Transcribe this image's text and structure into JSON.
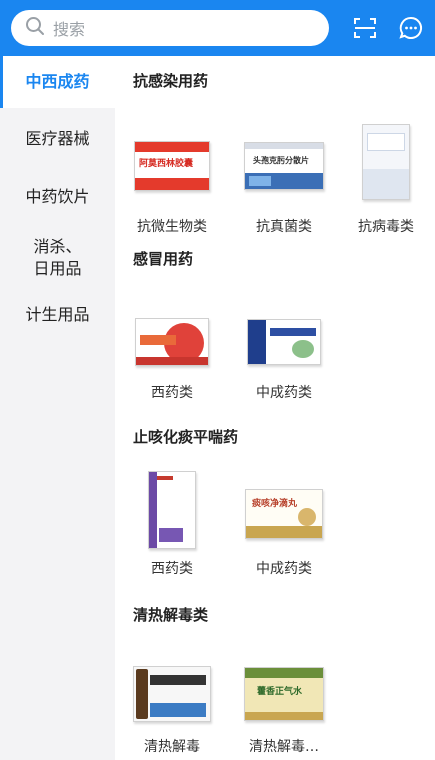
{
  "search": {
    "placeholder": "搜索"
  },
  "sidebar": {
    "items": [
      {
        "label": "中西成药",
        "active": true
      },
      {
        "label": "医疗器械"
      },
      {
        "label": "中药饮片"
      },
      {
        "label": "消杀、\n日用品"
      },
      {
        "label": "计生用品"
      }
    ]
  },
  "sections": [
    {
      "title": "抗感染用药",
      "products": [
        {
          "label": "抗微生物类",
          "box_text": "阿莫西林胶囊"
        },
        {
          "label": "抗真菌类",
          "box_text": "头孢克肟分散片"
        },
        {
          "label": "抗病毒类",
          "box_text": ""
        }
      ]
    },
    {
      "title": "感冒用药",
      "products": [
        {
          "label": "西药类",
          "box_text": ""
        },
        {
          "label": "中成药类",
          "box_text": ""
        }
      ]
    },
    {
      "title": "止咳化痰平喘药",
      "products": [
        {
          "label": "西药类",
          "box_text": ""
        },
        {
          "label": "中成药类",
          "box_text": "痰咳净滴丸"
        }
      ]
    },
    {
      "title": "清热解毒类",
      "products": [
        {
          "label": "清热解毒",
          "box_text": ""
        },
        {
          "label": "清热解毒…",
          "box_text": "藿香正气水"
        }
      ]
    }
  ],
  "colors": {
    "accent": "#1a86f0",
    "sidebar_bg": "#f3f3f5"
  },
  "icons": [
    "search-icon",
    "scan-icon",
    "message-icon"
  ]
}
